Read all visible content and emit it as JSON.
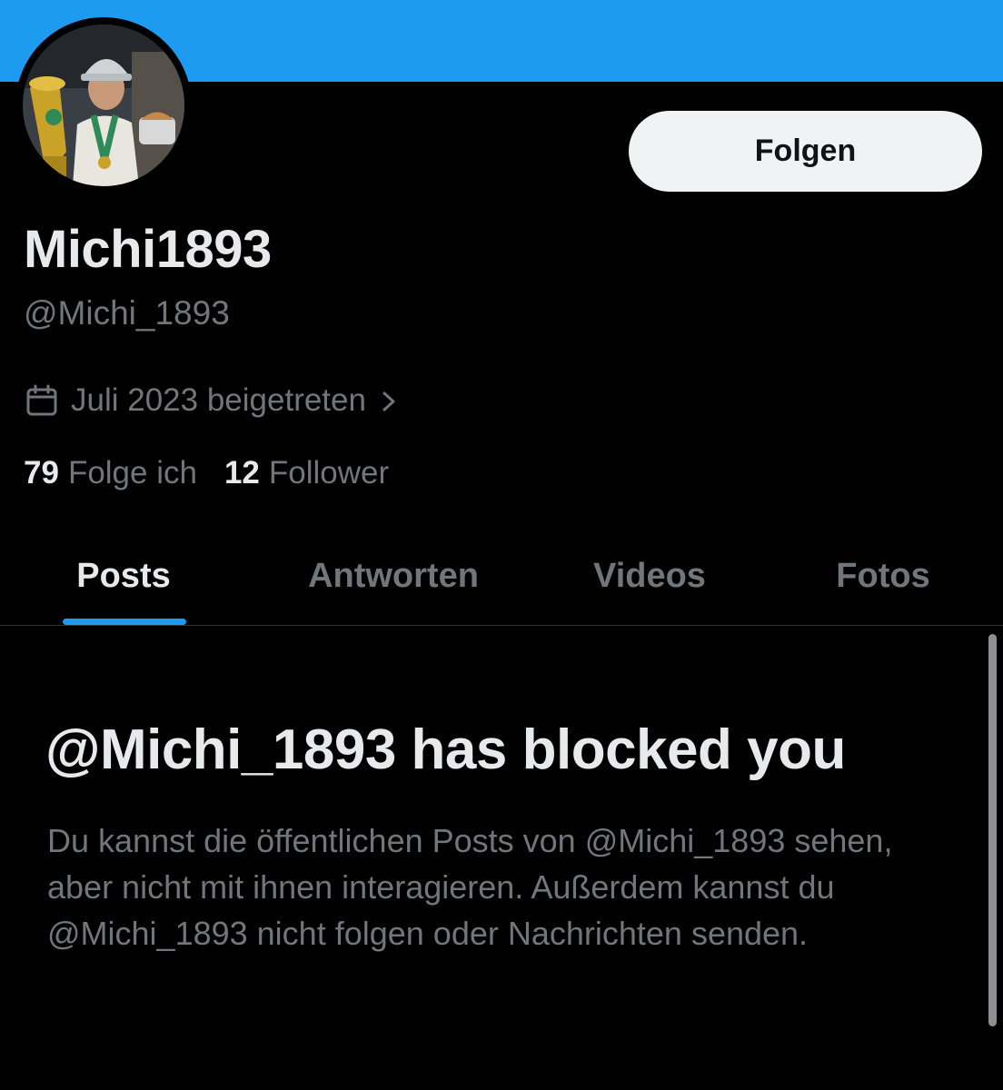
{
  "colors": {
    "banner": "#1d9bf0",
    "accent": "#1d9bf0",
    "background": "#000000",
    "primary_text": "#e7e9ea",
    "secondary_text": "#71767b",
    "follow_button_bg": "#eff3f4"
  },
  "profile": {
    "display_name": "Michi1893",
    "handle": "@Michi_1893",
    "joined": "Juli 2023 beigetreten",
    "follow_label": "Folgen",
    "avatar_icon": "profile-photo"
  },
  "stats": {
    "following_count": "79",
    "following_label": "Folge ich",
    "followers_count": "12",
    "followers_label": "Follower"
  },
  "tabs": [
    {
      "label": "Posts",
      "active": true
    },
    {
      "label": "Antworten",
      "active": false
    },
    {
      "label": "Videos",
      "active": false
    },
    {
      "label": "Fotos",
      "active": false
    }
  ],
  "blocked": {
    "title": "@Michi_1893 has blocked you",
    "body": "Du kannst die öffentlichen Posts von @Michi_1893 sehen, aber nicht mit ihnen interagieren. Außerdem kannst du @Michi_1893 nicht folgen oder Nachrichten senden."
  }
}
